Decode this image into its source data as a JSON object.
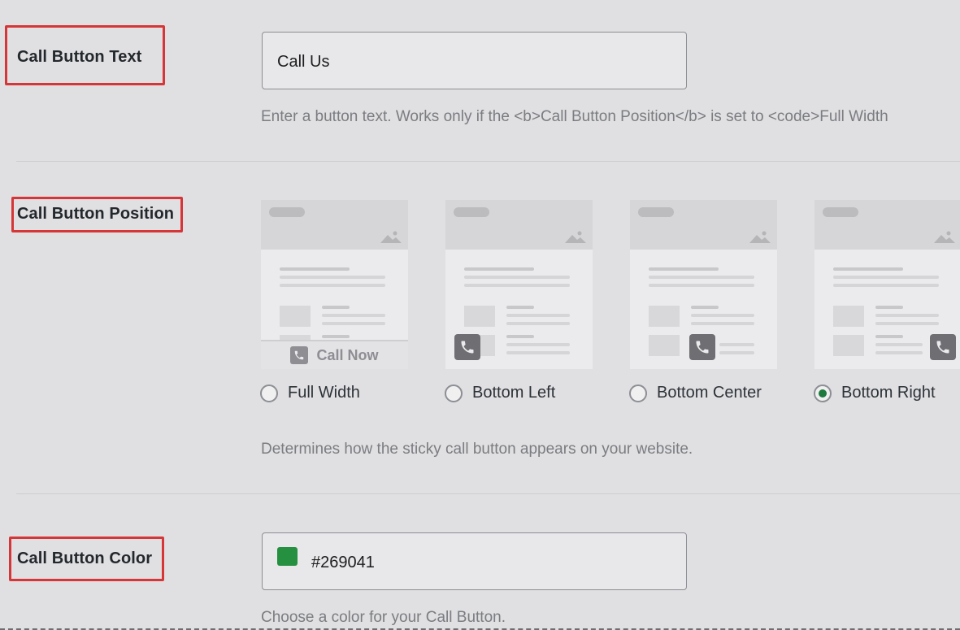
{
  "rows": {
    "text": {
      "label": "Call Button Text",
      "value": "Call Us",
      "description": "Enter a button text. Works only if the <b>Call Button Position</b> is set to <code>Full Width"
    },
    "position": {
      "label": "Call Button Position",
      "card_bar_text": "Call Now",
      "options": [
        {
          "label": "Full Width",
          "checked": false
        },
        {
          "label": "Bottom Left",
          "checked": false
        },
        {
          "label": "Bottom Center",
          "checked": false
        },
        {
          "label": "Bottom Right",
          "checked": true
        }
      ],
      "description": "Determines how the sticky call button appears on your website."
    },
    "color": {
      "label": "Call Button Color",
      "value": "#269041",
      "swatch_color": "#269041",
      "description": "Choose a color for your Call Button."
    }
  },
  "colors": {
    "highlight": "#d63638",
    "selected_radio": "#1e7a3e"
  },
  "icons": [
    "phone-icon",
    "mountain-image-icon"
  ]
}
